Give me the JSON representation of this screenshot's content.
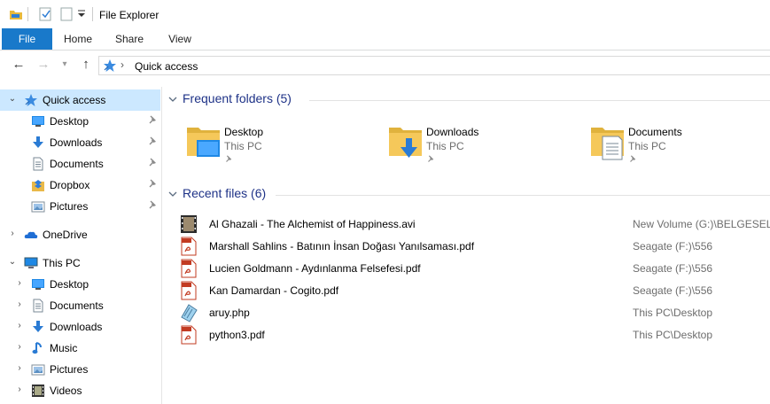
{
  "window": {
    "title": "File Explorer"
  },
  "ribbon": {
    "tabs": [
      "File",
      "Home",
      "Share",
      "View"
    ]
  },
  "address": {
    "path": "Quick access"
  },
  "sidebar": {
    "quick_access": {
      "label": "Quick access",
      "items": [
        {
          "label": "Desktop",
          "icon": "desktop-icon"
        },
        {
          "label": "Downloads",
          "icon": "downloads-icon"
        },
        {
          "label": "Documents",
          "icon": "documents-icon"
        },
        {
          "label": "Dropbox",
          "icon": "dropbox-icon"
        },
        {
          "label": "Pictures",
          "icon": "pictures-icon"
        }
      ]
    },
    "onedrive": {
      "label": "OneDrive"
    },
    "this_pc": {
      "label": "This PC",
      "items": [
        {
          "label": "Desktop",
          "icon": "desktop-icon"
        },
        {
          "label": "Documents",
          "icon": "documents-icon"
        },
        {
          "label": "Downloads",
          "icon": "downloads-icon"
        },
        {
          "label": "Music",
          "icon": "music-icon"
        },
        {
          "label": "Pictures",
          "icon": "pictures-icon"
        },
        {
          "label": "Videos",
          "icon": "videos-icon"
        }
      ]
    }
  },
  "frequent_folders": {
    "title": "Frequent folders (5)",
    "items": [
      {
        "name": "Desktop",
        "location": "This PC",
        "icon": "desktop-folder-icon"
      },
      {
        "name": "Downloads",
        "location": "This PC",
        "icon": "downloads-folder-icon"
      },
      {
        "name": "Documents",
        "location": "This PC",
        "icon": "documents-folder-icon"
      }
    ]
  },
  "recent_files": {
    "title": "Recent files (6)",
    "items": [
      {
        "name": "Al Ghazali - The Alchemist of Happiness.avi",
        "location": "New Volume (G:)\\BELGESEL\\Al",
        "icon": "video-file-icon"
      },
      {
        "name": "Marshall Sahlins - Batının İnsan Doğası Yanılsaması.pdf",
        "location": "Seagate (F:)\\556",
        "icon": "pdf-file-icon"
      },
      {
        "name": "Lucien Goldmann - Aydınlanma Felsefesi.pdf",
        "location": "Seagate (F:)\\556",
        "icon": "pdf-file-icon"
      },
      {
        "name": "Kan Damardan - Cogito.pdf",
        "location": "Seagate (F:)\\556",
        "icon": "pdf-file-icon"
      },
      {
        "name": "aruy.php",
        "location": "This PC\\Desktop",
        "icon": "php-file-icon"
      },
      {
        "name": "python3.pdf",
        "location": "This PC\\Desktop",
        "icon": "pdf-file-icon"
      }
    ]
  },
  "colors": {
    "accent": "#1979ca",
    "selected": "#cce8ff",
    "group_title": "#1e3287",
    "folder": "#f5c85a"
  }
}
